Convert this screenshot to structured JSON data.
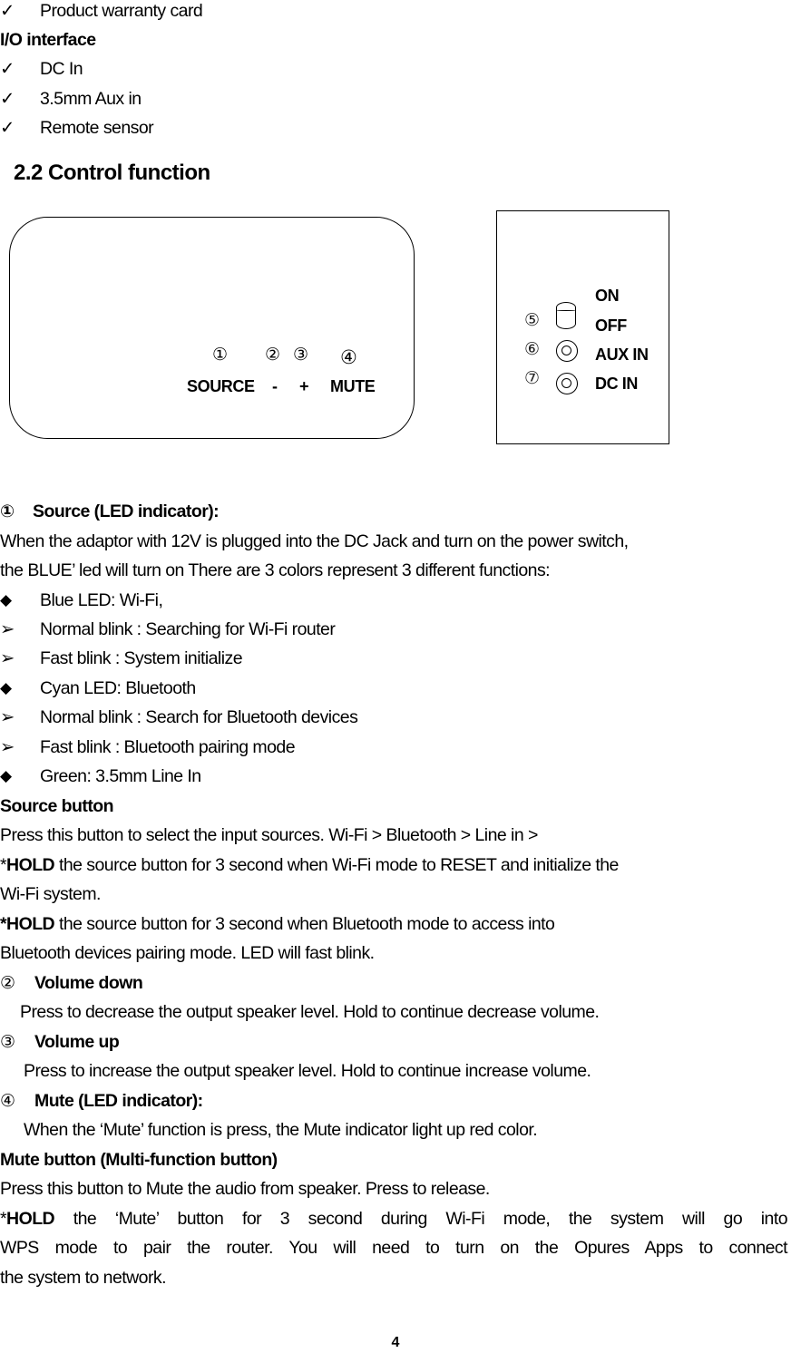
{
  "package_list": {
    "items": [
      {
        "icon": "checkmark-icon",
        "text": "Product warranty card"
      }
    ]
  },
  "io_interface": {
    "heading": "I/O interface",
    "items": [
      {
        "icon": "checkmark-icon",
        "text": "DC In"
      },
      {
        "icon": "checkmark-icon",
        "text": "3.5mm Aux in"
      },
      {
        "icon": "checkmark-icon",
        "text": "Remote sensor"
      }
    ]
  },
  "symbols": {
    "check": "✓",
    "diamond": "◆",
    "arrow": "➢"
  },
  "section": {
    "title": "2.2 Control function"
  },
  "front_panel": {
    "numbers": [
      "①",
      "②",
      "③",
      "④"
    ],
    "labels": [
      "SOURCE",
      "-",
      "+",
      "MUTE"
    ]
  },
  "rear_panel": {
    "numbers": [
      "⑤",
      "⑥",
      "⑦"
    ],
    "labels": [
      "ON",
      "OFF",
      "AUX IN",
      "DC IN"
    ]
  },
  "source": {
    "number": "①",
    "title": "Source (LED indicator):",
    "para": [
      "When the adaptor with 12V is plugged into the DC Jack and turn on the power switch,",
      "the BLUE’ led will turn on There are 3 colors represent 3 different functions:"
    ],
    "bullets": [
      {
        "type": "diamond",
        "text": "Blue LED: Wi-Fi,"
      },
      {
        "type": "arrow",
        "text": "Normal blink : Searching for Wi-Fi router"
      },
      {
        "type": "arrow",
        "text": "Fast blink : System initialize"
      },
      {
        "type": "diamond",
        "text": "Cyan LED: Bluetooth"
      },
      {
        "type": "arrow",
        "text": "Normal blink : Search for Bluetooth devices"
      },
      {
        "type": "arrow",
        "text": "Fast blink : Bluetooth pairing mode"
      },
      {
        "type": "diamond",
        "text": "Green: 3.5mm Line In"
      }
    ]
  },
  "source_button": {
    "title": "Source button",
    "line1": "Press this button to select the input sources. Wi-Fi > Bluetooth > Line in >",
    "hold": "HOLD",
    "star": "*",
    "line2_rest": " the source button for 3 second when Wi-Fi mode to RESET and initialize the",
    "line3": "Wi-Fi system.",
    "line4_rest": " the source button for 3 second when Bluetooth mode to access into",
    "line5": "Bluetooth devices pairing mode. LED will fast blink."
  },
  "volume_down": {
    "number": "②",
    "title": "Volume down",
    "text": "Press to decrease the output speaker level. Hold to continue decrease volume."
  },
  "volume_up": {
    "number": "③",
    "title": "Volume up",
    "text": "Press to increase the output speaker level. Hold to continue increase volume."
  },
  "mute": {
    "number": "④",
    "title": "Mute (LED indicator):",
    "text": "When the ‘Mute’ function is press, the Mute indicator light up red color."
  },
  "mute_button": {
    "title": "Mute button (Multi-function button)",
    "line1": "Press this button to Mute the audio from speaker. Press to release.",
    "star": "*",
    "hold": "HOLD",
    "line2_rest": " the ‘Mute’ button for 3 second during Wi-Fi mode, the system will go into",
    "line3": "WPS mode to pair the router. You will need to turn on the Opures Apps to connect",
    "line4": "the system to network."
  },
  "page": {
    "number": "4"
  }
}
